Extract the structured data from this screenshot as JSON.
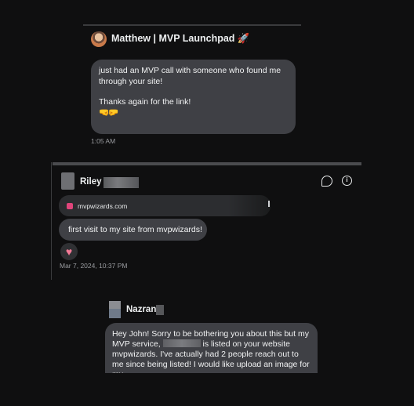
{
  "panel1": {
    "sender_name": "Matthew | MVP Launchpad 🚀",
    "message_line1": "just had an MVP call with someone who found me",
    "message_line2": "through your site!",
    "message_line3": "Thanks again for the link!",
    "emoji": "🤜🤛",
    "timestamp": "1:05 AM"
  },
  "panel2": {
    "sender_name": "Riley",
    "link_domain": "mvpwizards.com",
    "message": "first visit to my site from mvpwizards!",
    "reaction": "♥",
    "timestamp": "Mar 7, 2024, 10:37 PM",
    "icons": [
      "comment-icon",
      "info-icon"
    ]
  },
  "panel3": {
    "sender_name": "Nazran",
    "message_part1": "Hey John! Sorry to be bothering you about this but my MVP service,",
    "message_part2": "is listed on your website mvpwizards. I've actually had 2 people reach out to me since being listed! I would like upload an image for my"
  },
  "colors": {
    "background": "#0f0f10",
    "bubble": "#3f4045",
    "heart": "#f47a97"
  }
}
